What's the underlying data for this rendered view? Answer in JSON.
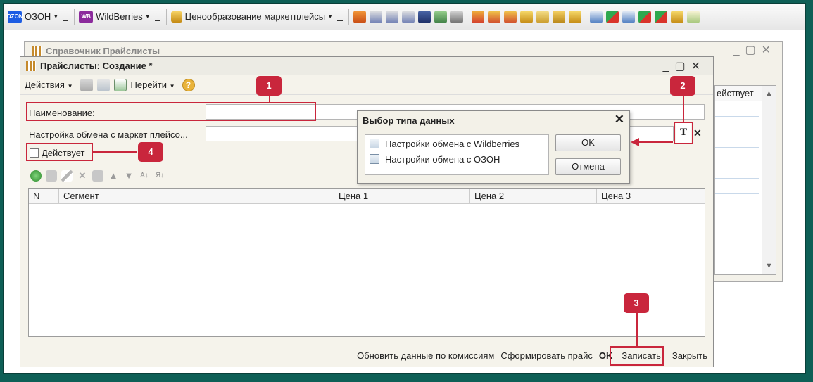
{
  "topbar": {
    "ozon_logo": "OZON",
    "ozon_label": "ОЗОН",
    "wb_logo": "WB",
    "wb_label": "WildBerries",
    "pricing_label": "Ценообразование маркетплейсы",
    "icons": [
      "orange-box-icon",
      "printer-icon",
      "printer-icon",
      "printer-icon",
      "people-icon",
      "calculator-icon",
      "scale-icon",
      "money-red-icon",
      "hand-money-icon",
      "hand-money-icon",
      "coins-icon",
      "hand-coins-icon",
      "coins-stack-icon",
      "coins-icon",
      "report-icon",
      "arrows-icon",
      "report-icon",
      "arrows-icon",
      "arrows-icon",
      "coins-icon",
      "image-icon"
    ]
  },
  "bg_window": {
    "title": "Справочник Прайслисты",
    "column": "ействует"
  },
  "form": {
    "title": "Прайслисты: Создание *",
    "toolbar": {
      "actions": "Действия",
      "goto": "Перейти",
      "help": "?"
    },
    "name_label": "Наименование:",
    "name_value": "",
    "exchange_label": "Настройка обмена с маркет плейсо...",
    "exchange_value": "",
    "active_label": "Действует",
    "active_checked": false,
    "grid_columns": [
      "N",
      "Сегмент",
      "Цена 1",
      "Цена 2",
      "Цена 3"
    ],
    "grid_rows": [],
    "footer": {
      "update": "Обновить данные по комиссиям",
      "generate": "Сформировать прайс",
      "ok": "OK",
      "save": "Записать",
      "close": "Закрыть"
    },
    "type_button": "T",
    "clear_button": "✕"
  },
  "dialog": {
    "title": "Выбор типа данных",
    "items": [
      "Настройки обмена с Wildberries",
      "Настройки обмена с ОЗОН"
    ],
    "ok": "OK",
    "cancel": "Отмена"
  },
  "annotations": [
    "1",
    "2",
    "3",
    "4"
  ],
  "colors": {
    "accent": "#c9263c",
    "background": "#0e5f56"
  }
}
